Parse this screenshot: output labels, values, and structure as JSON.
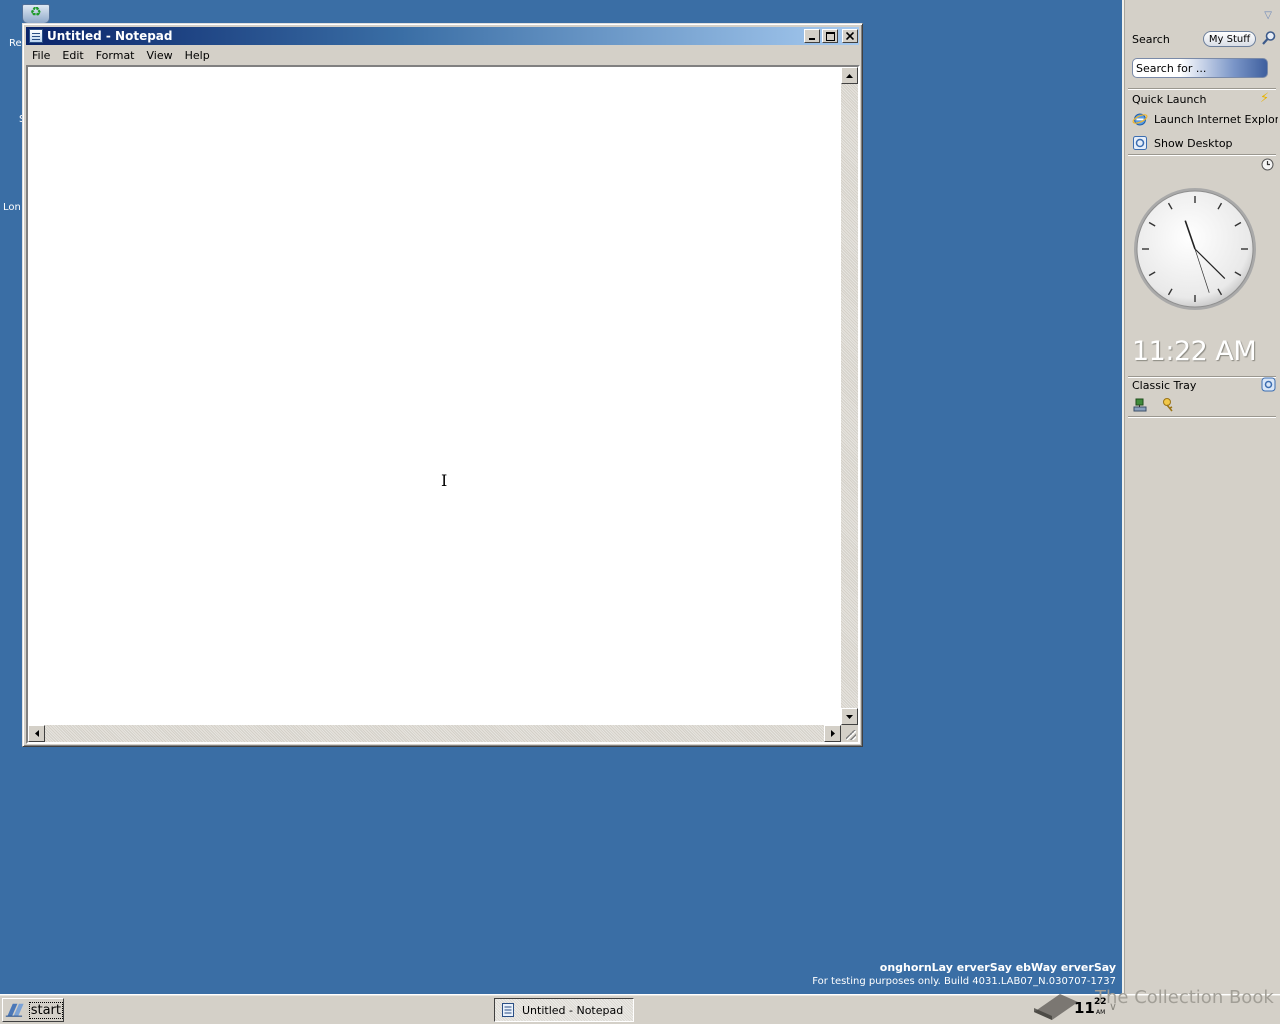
{
  "desktop": {
    "icon_labels": [
      "Re",
      "S",
      "Lon"
    ]
  },
  "window": {
    "title": "Untitled - Notepad",
    "controls": {
      "minimize": "_",
      "maximize": "□",
      "close": "✕"
    },
    "menu": [
      "File",
      "Edit",
      "Format",
      "View",
      "Help"
    ],
    "content": ""
  },
  "sidebar": {
    "search_label": "Search",
    "mystuff_label": "My Stuff",
    "search_placeholder": "Search for ...",
    "quick_launch_title": "Quick Launch",
    "quick_launch_items": [
      "Launch Internet Explorer",
      "Show Desktop"
    ],
    "digital_time": "11:22 AM",
    "classic_tray_title": "Classic Tray",
    "clock": {
      "hours": 11,
      "minutes": 22,
      "seconds": 27
    }
  },
  "watermark": {
    "line1": "onghornLay erverSay ebWay erverSay",
    "line2": "For testing purposes only. Build 4031.LAB07_N.030707-1737"
  },
  "taskbar": {
    "start_label": "start",
    "task_label": "Untitled - Notepad",
    "time_hour": "11",
    "time_min": "22",
    "time_ampm": "AM",
    "collection_text": "The Collection Book"
  },
  "colors": {
    "desktop": "#3a6ea5",
    "title_active": "#0a246a",
    "face": "#d4d0c8"
  }
}
